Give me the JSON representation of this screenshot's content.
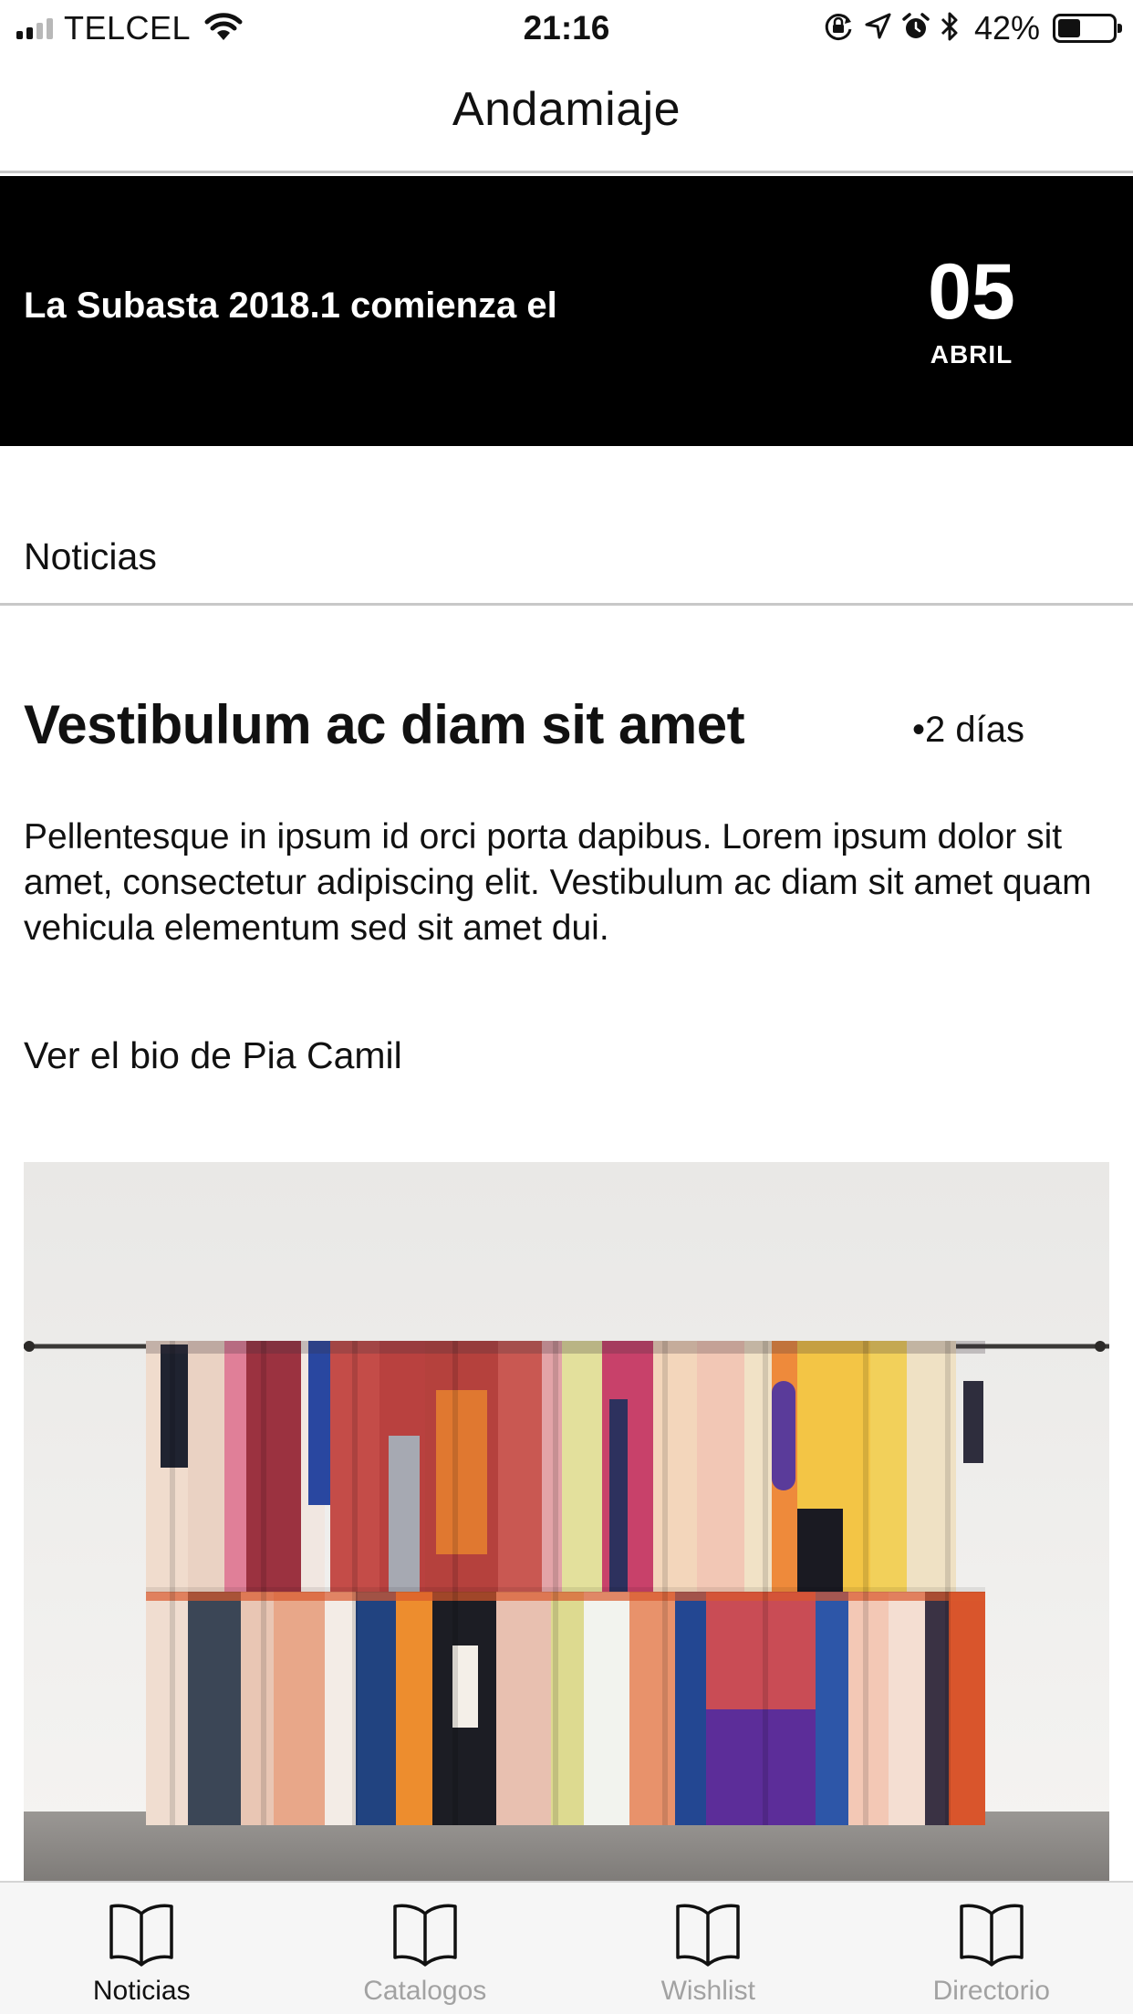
{
  "status_bar": {
    "carrier": "TELCEL",
    "time": "21:16",
    "battery_percent": "42%",
    "battery_level": 0.42,
    "signal_bars_filled": 2,
    "signal_bars_total": 4,
    "icons": [
      "signal-icon",
      "wifi-icon",
      "rotation-lock-icon",
      "location-arrow-icon",
      "alarm-icon",
      "bluetooth-icon",
      "battery-icon"
    ]
  },
  "nav": {
    "title": "Andamiaje"
  },
  "banner": {
    "text": "La Subasta 2018.1 comienza el",
    "day": "05",
    "month": "ABRIL",
    "background_color": "#000000",
    "text_color": "#ffffff"
  },
  "section": {
    "title": "Noticias"
  },
  "article": {
    "title": "Vestibulum ac diam sit amet",
    "age": "•2 días",
    "body": "Pellentesque in ipsum id orci porta dapibus. Lorem ipsum dolor sit amet, consectetur adipiscing elit. Vestibulum ac diam sit amet quam vehicula elementum sed sit amet dui.",
    "link": "Ver el bio de Pia Camil",
    "image": "artwork-photo-colorful-curtain"
  },
  "tab_bar": {
    "tabs": [
      {
        "label": "Noticias",
        "icon": "book-icon",
        "active": true
      },
      {
        "label": "Catalogos",
        "icon": "book-icon",
        "active": false
      },
      {
        "label": "Wishlist",
        "icon": "book-icon",
        "active": false
      },
      {
        "label": "Directorio",
        "icon": "book-icon",
        "active": false
      }
    ],
    "active_color": "#111111",
    "inactive_color": "#a2a2a2"
  }
}
